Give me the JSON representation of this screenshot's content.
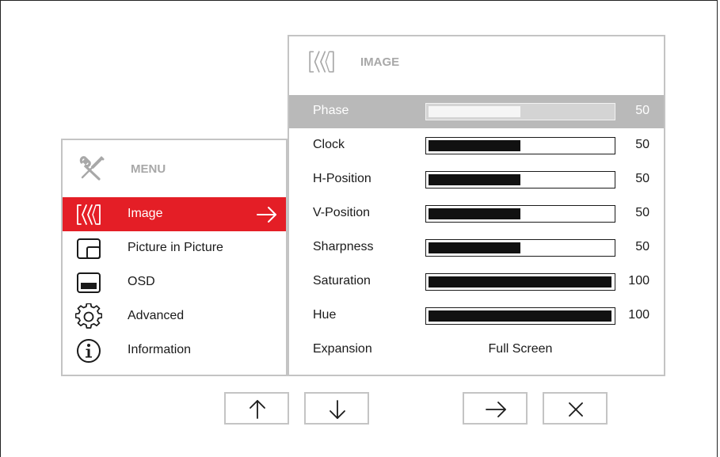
{
  "menu": {
    "title": "MENU",
    "header_icon": "tools-icon",
    "items": [
      {
        "label": "Image",
        "icon": "image-waves-icon",
        "active": true
      },
      {
        "label": "Picture in Picture",
        "icon": "picture-in-picture-icon",
        "active": false
      },
      {
        "label": "OSD",
        "icon": "osd-icon",
        "active": false
      },
      {
        "label": "Advanced",
        "icon": "gear-icon",
        "active": false
      },
      {
        "label": "Information",
        "icon": "info-icon",
        "active": false
      }
    ]
  },
  "image_panel": {
    "title": "IMAGE",
    "header_icon": "image-waves-icon",
    "rows": [
      {
        "label": "Phase",
        "value": "50",
        "level": 50,
        "selected": true
      },
      {
        "label": "Clock",
        "value": "50",
        "level": 50,
        "selected": false
      },
      {
        "label": "H-Position",
        "value": "50",
        "level": 50,
        "selected": false
      },
      {
        "label": "V-Position",
        "value": "50",
        "level": 50,
        "selected": false
      },
      {
        "label": "Sharpness",
        "value": "50",
        "level": 50,
        "selected": false
      },
      {
        "label": "Saturation",
        "value": "100",
        "level": 100,
        "selected": false
      },
      {
        "label": "Hue",
        "value": "100",
        "level": 100,
        "selected": false
      }
    ],
    "expansion": {
      "label": "Expansion",
      "value": "Full Screen"
    }
  },
  "nav_buttons": [
    {
      "icon": "arrow-up-icon"
    },
    {
      "icon": "arrow-down-icon"
    },
    {
      "icon": "arrow-right-icon"
    },
    {
      "icon": "close-icon"
    }
  ],
  "colors": {
    "accent_red": "#e41e26",
    "selected_gray": "#b9b9b9",
    "border_gray": "#c4c4c4",
    "header_text_gray": "#a8a8a8"
  }
}
